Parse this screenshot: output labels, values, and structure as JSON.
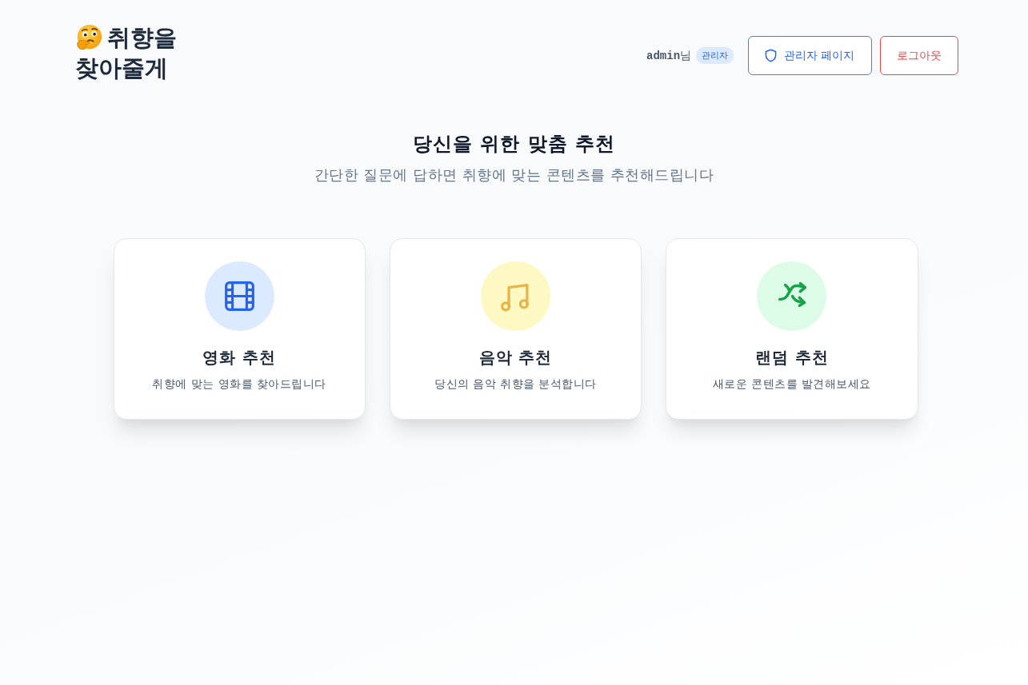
{
  "header": {
    "brand": {
      "lines": [
        "취향을",
        "찾아줄게"
      ]
    },
    "user": "**admin**님",
    "role_badge": "관리자",
    "buttons": [
      {
        "kind": "admin",
        "label": "관리자 페이지"
      },
      {
        "kind": "logout",
        "label": "로그아웃"
      }
    ]
  },
  "hero": {
    "title": "당신을 위한 맞춤 추천",
    "subtitle": "간단한 질문에 답하면 취향에 맞는 콘텐츠를 추천해드립니다"
  },
  "cards": [
    {
      "kind": "movie",
      "title": "영화 추천",
      "description": "취향에 맞는 영화를 찾아드립니다"
    },
    {
      "kind": "music",
      "title": "음악 추천",
      "description": "당신의 음악 취향을 분석합니다"
    },
    {
      "kind": "random",
      "title": "랜덤 추천",
      "description": "새로운 콘텐츠를 발견해보세요"
    }
  ]
}
